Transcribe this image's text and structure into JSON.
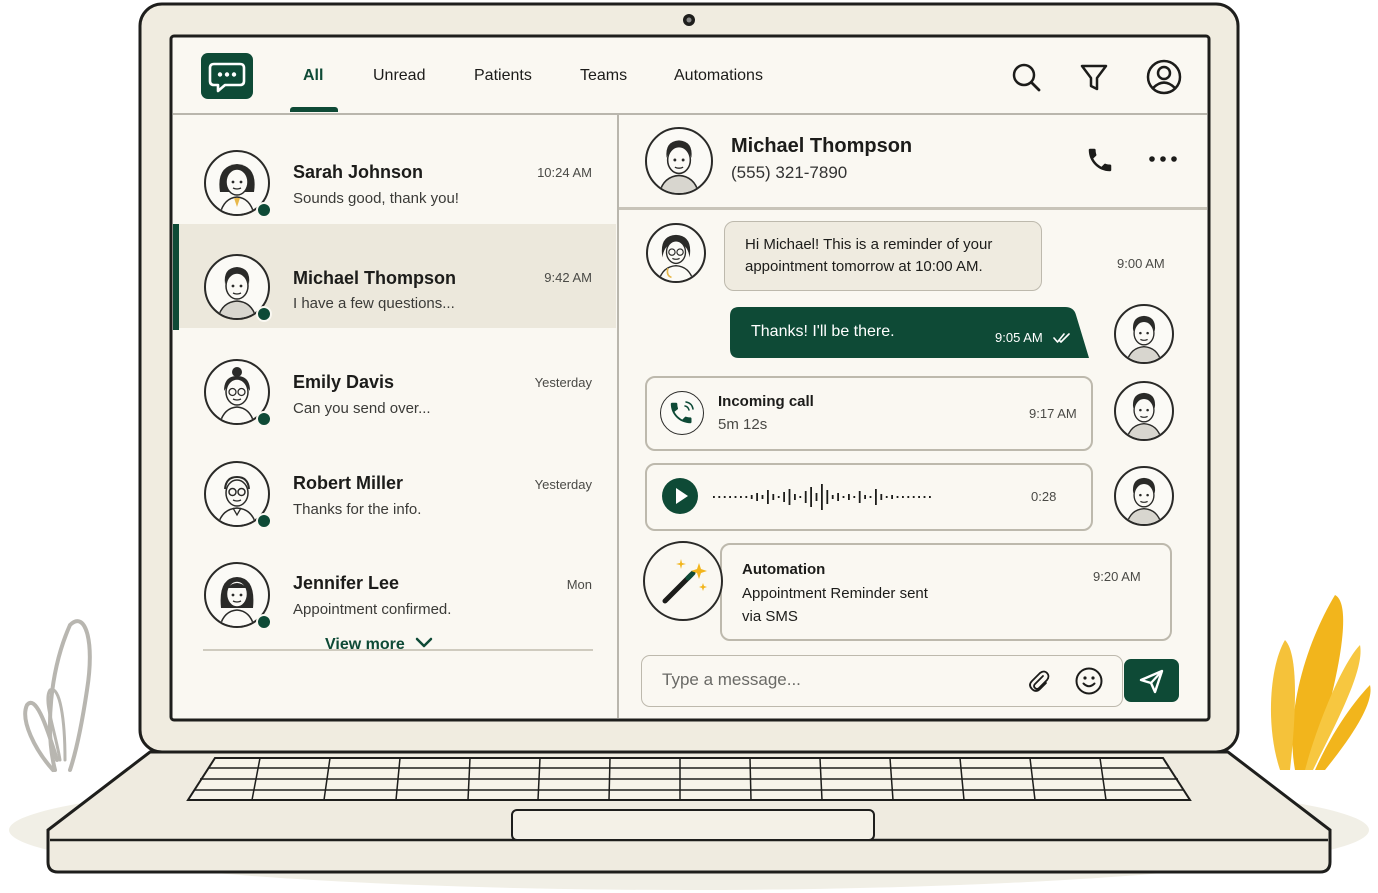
{
  "nav": {
    "tabs": [
      {
        "label": "All",
        "active": true
      },
      {
        "label": "Unread"
      },
      {
        "label": "Patients"
      },
      {
        "label": "Teams"
      },
      {
        "label": "Automations"
      }
    ],
    "icons": [
      "chat-bubble-icon",
      "search-icon",
      "filter-icon",
      "user-account-icon"
    ]
  },
  "conversations": [
    {
      "name": "Sarah Johnson",
      "preview": "Sounds good, thank you!",
      "time": "10:24 AM",
      "online": true
    },
    {
      "name": "Michael Thompson",
      "preview": "I have a few questions...",
      "time": "9:42 AM",
      "online": true,
      "active": true
    },
    {
      "name": "Emily Davis",
      "preview": "Can you send over...",
      "time": "Yesterday",
      "online": true
    },
    {
      "name": "Robert Miller",
      "preview": "Thanks for the info.",
      "time": "Yesterday",
      "online": true
    },
    {
      "name": "Jennifer Lee",
      "preview": "Appointment confirmed.",
      "time": "Mon",
      "online": true
    }
  ],
  "view_more_label": "View more",
  "chat": {
    "contact_name": "Michael Thompson",
    "contact_phone": "(555) 321-7890",
    "messages": {
      "reminder": {
        "text_line1": "Hi Michael! This is a reminder of your",
        "text_line2": "appointment tomorrow at 10:00 AM.",
        "time": "9:00 AM"
      },
      "reply": {
        "text": "Thanks! I'll be there.",
        "time": "9:05 AM"
      },
      "call": {
        "title": "Incoming call",
        "duration": "5m 12s",
        "time": "9:17 AM"
      },
      "voice": {
        "duration": "0:28"
      },
      "automation": {
        "title": "Automation",
        "line1": "Appointment Reminder sent",
        "line2": "via SMS",
        "time": "9:20 AM"
      }
    },
    "composer_placeholder": "Type a message..."
  },
  "colors": {
    "brand": "#0e4a36",
    "background": "#faf8f2",
    "accent_plant": "#f2b51c"
  }
}
